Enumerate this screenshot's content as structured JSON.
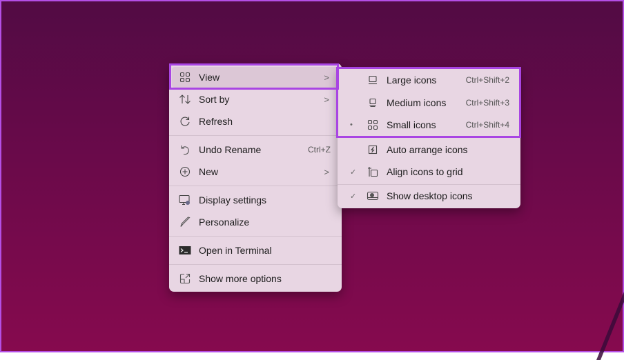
{
  "desktop": {
    "background_colors": [
      "#520b44",
      "#860a4e"
    ],
    "border_color": "#b44fe6"
  },
  "context_menu": {
    "items": [
      {
        "label": "View",
        "icon": "grid-icon",
        "submenu": true,
        "highlighted": true
      },
      {
        "label": "Sort by",
        "icon": "sort-arrows-icon",
        "submenu": true
      },
      {
        "label": "Refresh",
        "icon": "refresh-icon"
      },
      {
        "label": "Undo Rename",
        "icon": "undo-icon",
        "shortcut": "Ctrl+Z"
      },
      {
        "label": "New",
        "icon": "plus-circle-icon",
        "submenu": true
      },
      {
        "label": "Display settings",
        "icon": "display-settings-icon"
      },
      {
        "label": "Personalize",
        "icon": "brush-icon"
      },
      {
        "label": "Open in Terminal",
        "icon": "terminal-icon"
      },
      {
        "label": "Show more options",
        "icon": "expand-icon"
      }
    ],
    "chevron": ">"
  },
  "view_submenu": {
    "items": [
      {
        "label": "Large icons",
        "icon": "large-icons-icon",
        "shortcut": "Ctrl+Shift+2",
        "mark": ""
      },
      {
        "label": "Medium icons",
        "icon": "medium-icons-icon",
        "shortcut": "Ctrl+Shift+3",
        "mark": ""
      },
      {
        "label": "Small icons",
        "icon": "small-icons-icon",
        "shortcut": "Ctrl+Shift+4",
        "mark": "•",
        "selected": true
      },
      {
        "label": "Auto arrange icons",
        "icon": "auto-arrange-icon",
        "mark": ""
      },
      {
        "label": "Align icons to grid",
        "icon": "align-grid-icon",
        "mark": "✓",
        "checked": true
      },
      {
        "label": "Show desktop icons",
        "icon": "show-desktop-icon",
        "mark": "✓",
        "checked": true
      }
    ]
  },
  "annotation": {
    "highlight_color": "#a945e3"
  }
}
